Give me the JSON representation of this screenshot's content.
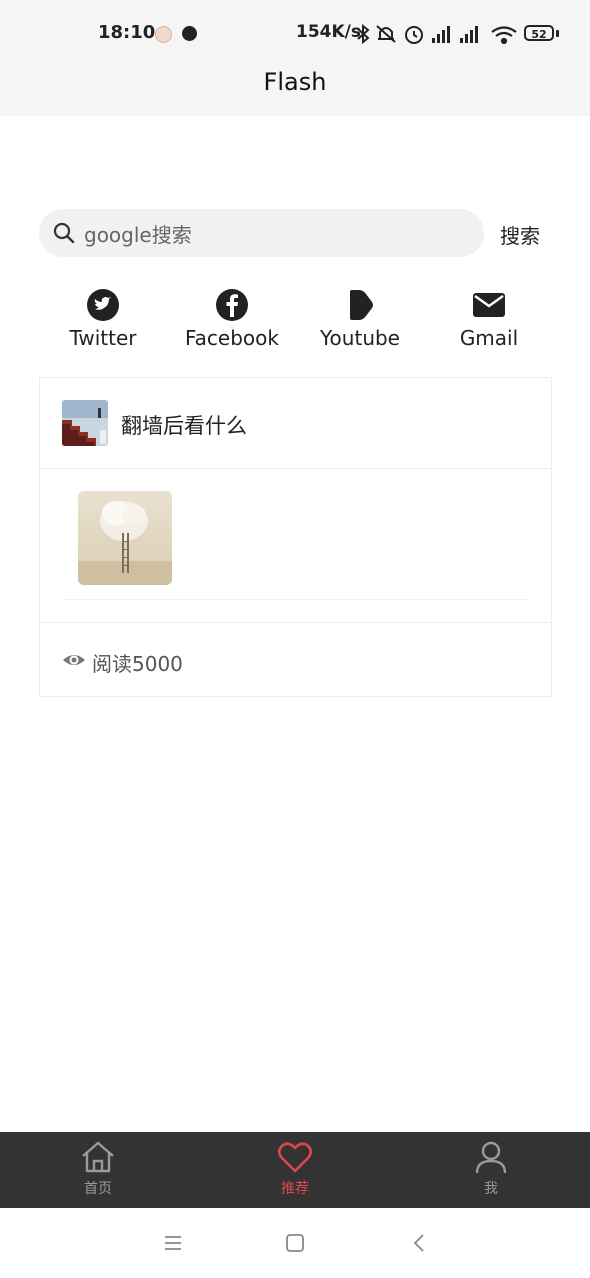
{
  "status_bar": {
    "time": "18:10",
    "net_speed": "154K/s",
    "battery": "52"
  },
  "header": {
    "title": "Flash"
  },
  "search": {
    "placeholder": "google搜索",
    "button_label": "搜索"
  },
  "quick_links": [
    {
      "label": "Twitter",
      "icon": "twitter-icon"
    },
    {
      "label": "Facebook",
      "icon": "facebook-icon"
    },
    {
      "label": "Youtube",
      "icon": "youtube-play-icon"
    },
    {
      "label": "Gmail",
      "icon": "mail-icon"
    }
  ],
  "post": {
    "title": "翻墙后看什么",
    "read_count": "阅读5000"
  },
  "bottom_nav": {
    "items": [
      {
        "label": "首页",
        "icon": "home-icon"
      },
      {
        "label": "推荐",
        "icon": "heart-icon",
        "active": true
      },
      {
        "label": "我",
        "icon": "user-icon"
      }
    ]
  },
  "colors": {
    "accent": "#e0474c",
    "nav_bg": "#333333",
    "header_bg": "#f5f5f5"
  }
}
